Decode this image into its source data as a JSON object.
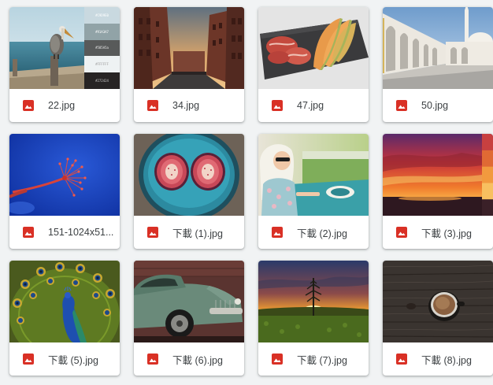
{
  "files": [
    {
      "name": "22.jpg",
      "type_icon": "image-file-icon",
      "thumbnail": "pelican-on-pier-with-color-palette"
    },
    {
      "name": "34.jpg",
      "type_icon": "image-file-icon",
      "thumbnail": "brick-canal-buildings-at-dusk"
    },
    {
      "name": "47.jpg",
      "type_icon": "image-file-icon",
      "thumbnail": "melon-and-prosciutto-on-slate"
    },
    {
      "name": "50.jpg",
      "type_icon": "image-file-icon",
      "thumbnail": "white-mosque-arcade"
    },
    {
      "name": "151-1024x51...",
      "type_icon": "image-file-icon",
      "thumbnail": "red-dandelion-seed-on-blue"
    },
    {
      "name": "下載 (1).jpg",
      "type_icon": "image-file-icon",
      "thumbnail": "halved-figs-in-teal-bowl"
    },
    {
      "name": "下載 (2).jpg",
      "type_icon": "image-file-icon",
      "thumbnail": "woman-in-vintage-car"
    },
    {
      "name": "下載 (3).jpg",
      "type_icon": "image-file-icon",
      "thumbnail": "red-sunset-over-water"
    },
    {
      "name": "下載 (5).jpg",
      "type_icon": "image-file-icon",
      "thumbnail": "peacock-displaying-feathers"
    },
    {
      "name": "下載 (6).jpg",
      "type_icon": "image-file-icon",
      "thumbnail": "rusty-green-vintage-car"
    },
    {
      "name": "下載 (7).jpg",
      "type_icon": "image-file-icon",
      "thumbnail": "sunset-over-field-with-tree"
    },
    {
      "name": "下載 (8).jpg",
      "type_icon": "image-file-icon",
      "thumbnail": "coffee-cup-on-dark-wood"
    }
  ],
  "palette_swatches": [
    {
      "label": "#C9D9E0",
      "color": "#c9d9e0"
    },
    {
      "label": "#91A3A7",
      "color": "#91a3a7"
    },
    {
      "label": "#585A5a",
      "color": "#585a5a"
    },
    {
      "label": "#FFFFFF",
      "color": "#eef2f3"
    },
    {
      "label": "#272424",
      "color": "#272424"
    }
  ],
  "colors": {
    "background": "#f1f3f4",
    "card": "#ffffff",
    "file_text": "#3c4043",
    "image_icon_red": "#d93025"
  }
}
